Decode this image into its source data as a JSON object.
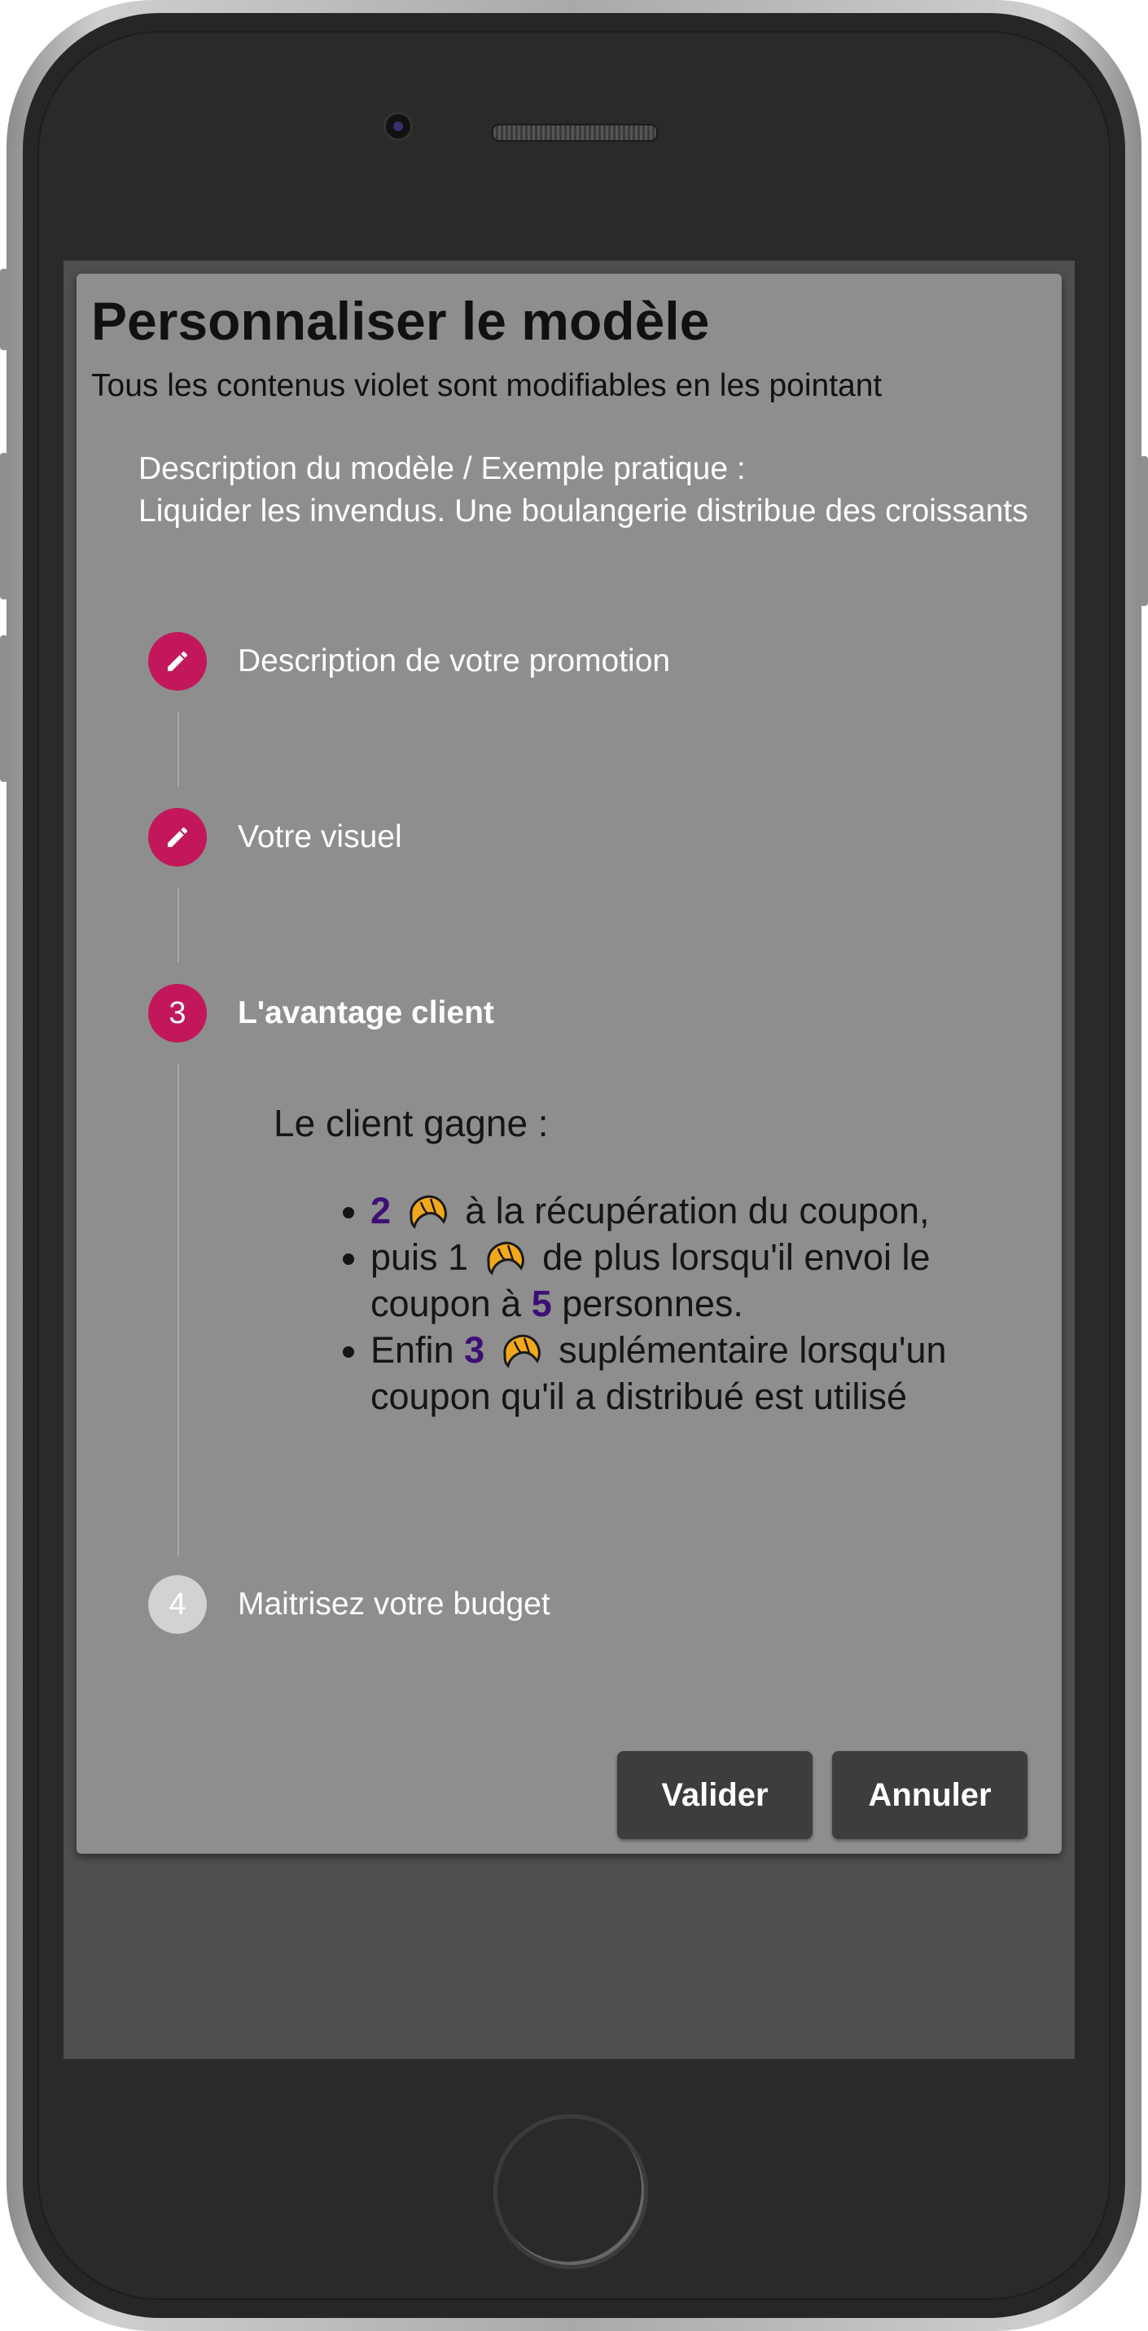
{
  "dialog": {
    "title": "Personnaliser le modèle",
    "subtitle": "Tous les contenus violet sont modifiables en les pointant",
    "description_heading": "Description du modèle / Exemple pratique :",
    "description_text": "Liquider les invendus. Une boulangerie distribue des croissants"
  },
  "steps": [
    {
      "label": "Description de votre promotion",
      "icon": "pencil-icon",
      "state": "completed"
    },
    {
      "label": "Votre visuel",
      "icon": "pencil-icon",
      "state": "completed"
    },
    {
      "number": "3",
      "label": "L'avantage client",
      "state": "active"
    },
    {
      "number": "4",
      "label": "Maitrisez votre budget",
      "state": "inactive"
    }
  ],
  "gain": {
    "title": "Le client gagne :",
    "item1": {
      "num": "2",
      "text": "à la récupération du coupon,"
    },
    "item2": {
      "prefix": "puis 1",
      "text_a": "de plus lorsqu'il envoi le coupon à",
      "num": "5",
      "text_b": "personnes."
    },
    "item3": {
      "prefix": "Enfin",
      "num": "3",
      "text": "suplémentaire lorsqu'un coupon qu'il a distribué est utilisé"
    },
    "reward_icon": "croissant-icon"
  },
  "buttons": {
    "validate": "Valider",
    "cancel": "Annuler"
  },
  "colors": {
    "accent": "#c2185b",
    "editable": "#3d0f74",
    "dialog_bg": "#8e8e8e",
    "button_bg": "#3d3d3d"
  }
}
